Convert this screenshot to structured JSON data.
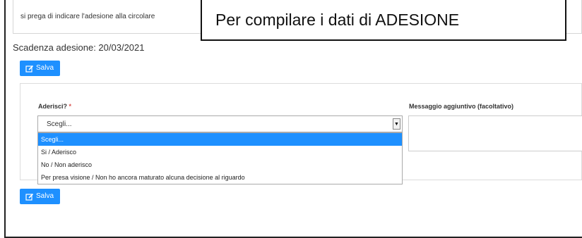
{
  "notice": {
    "text": "si prega di indicare l'adesione alla circolare"
  },
  "callout": {
    "text": "Per compilare i dati di ADESIONE"
  },
  "deadline": {
    "text": "Scadenza adesione: 20/03/2021"
  },
  "buttons": {
    "save_label": "Salva",
    "icon": "edit-icon"
  },
  "form": {
    "adhere_label": "Aderisci?",
    "required_mark": "*",
    "message_label": "Messaggio aggiuntivo (facoltativo)",
    "select": {
      "value": "Scegli...",
      "options": [
        "Scegli...",
        "Si / Aderisco",
        "No / Non aderisco",
        "Per presa visione / Non ho ancora maturato alcuna decisione al riguardo"
      ]
    }
  },
  "colors": {
    "accent": "#1e90ff",
    "required": "#d9534f"
  }
}
